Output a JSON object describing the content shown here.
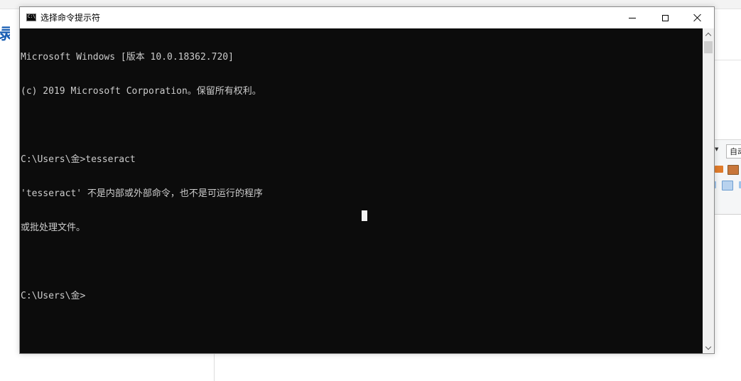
{
  "background": {
    "logo_fragment": "录",
    "ribbon_combo_text": "自动"
  },
  "window": {
    "title": "选择命令提示符",
    "icon": "cmd-icon",
    "controls": {
      "minimize_icon": "minimize-icon",
      "maximize_icon": "maximize-icon",
      "close_icon": "close-icon"
    }
  },
  "console": {
    "lines": [
      "Microsoft Windows [版本 10.0.18362.720]",
      "(c) 2019 Microsoft Corporation。保留所有权利。",
      "",
      "C:\\Users\\金>tesseract",
      "'tesseract' 不是内部或外部命令，也不是可运行的程序",
      "或批处理文件。",
      "",
      "C:\\Users\\金>"
    ],
    "colors": {
      "background": "#0c0c0c",
      "text": "#cccccc",
      "cursor": "#f2f2f2"
    }
  }
}
